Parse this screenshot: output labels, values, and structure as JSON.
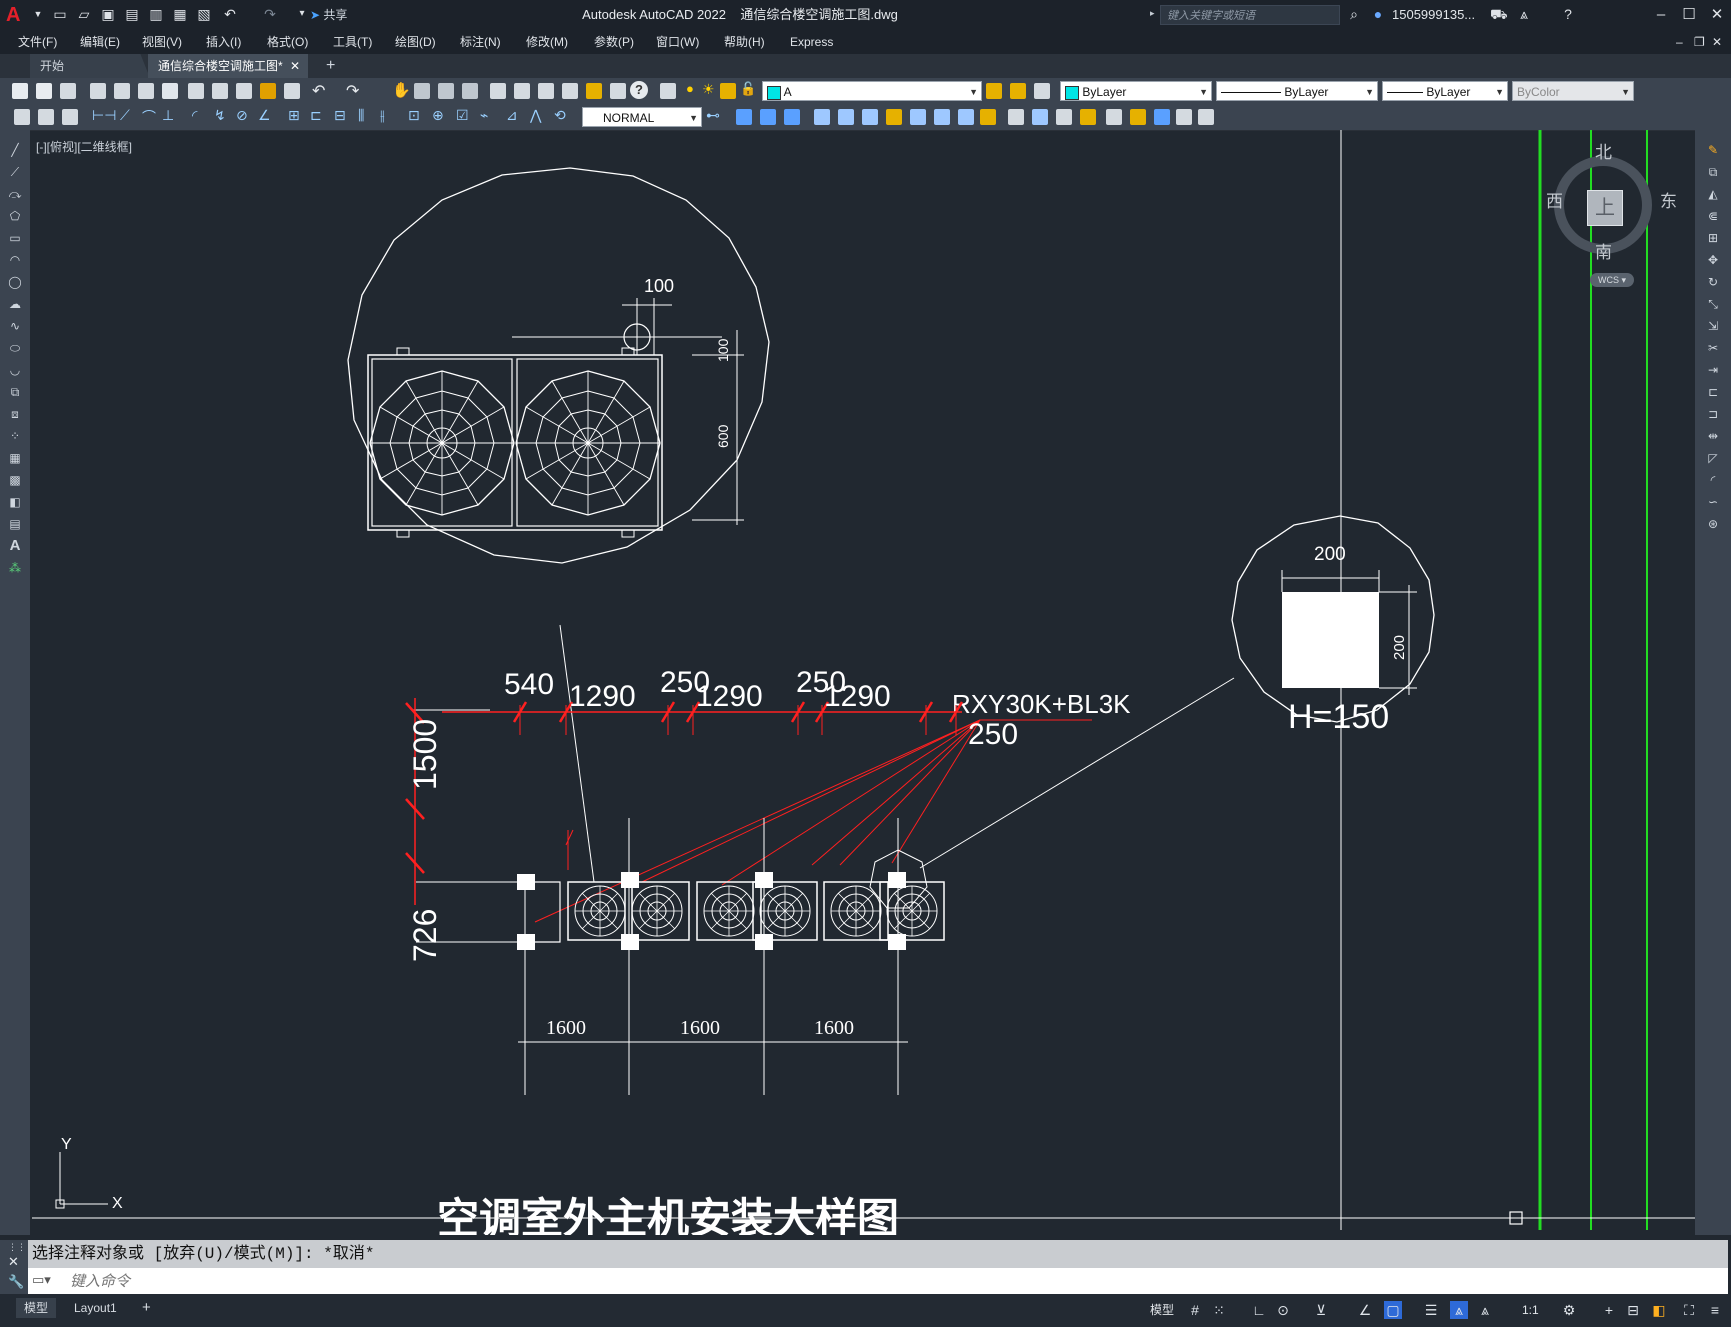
{
  "title_bar": {
    "app_name": "Autodesk AutoCAD 2022",
    "file_name": "通信综合楼空调施工图.dwg",
    "share_label": "共享",
    "search_placeholder": "键入关键字或短语",
    "user_name": "1505999135...",
    "help_label": "?"
  },
  "menu": [
    "文件(F)",
    "编辑(E)",
    "视图(V)",
    "插入(I)",
    "格式(O)",
    "工具(T)",
    "绘图(D)",
    "标注(N)",
    "修改(M)",
    "参数(P)",
    "窗口(W)",
    "帮助(H)",
    "Express"
  ],
  "tabs": {
    "start": "开始",
    "drawing": "通信综合楼空调施工图*",
    "add": "+"
  },
  "toolbar": {
    "layer_name": "A",
    "layer_color": "#00e5e5",
    "color_value": "ByLayer",
    "linetype_value": "ByLayer",
    "lineweight_value": "ByLayer",
    "plotstyle_value": "ByColor",
    "dimstyle_value": "NORMAL"
  },
  "viewport_label": "[-][俯视][二维线框]",
  "viewcube": {
    "north": "北",
    "south": "南",
    "east": "东",
    "west": "西",
    "face": "上",
    "wcs": "WCS"
  },
  "drawing": {
    "detail_top_dims": {
      "d100_top": "100",
      "d100_side": "100",
      "d600": "600"
    },
    "detail_right_dims": {
      "width": "200",
      "height": "200",
      "h_label": "H=150"
    },
    "model_label": "RXY30K+BL3K",
    "top_dims": [
      "540",
      "1290",
      "250",
      "1290",
      "250",
      "1290",
      "250"
    ],
    "left_dims": [
      "1500",
      "726"
    ],
    "bottom_dims": [
      "1600",
      "1600",
      "1600"
    ],
    "title": "空调室外主机安装大样图",
    "ucs_x": "X",
    "ucs_y": "Y"
  },
  "command": {
    "history": "选择注释对象或 [放弃(U)/模式(M)]: *取消*",
    "placeholder": "键入命令"
  },
  "status": {
    "model_tab": "模型",
    "layout_tab": "Layout1",
    "model_space": "模型",
    "scale": "1:1"
  },
  "colors": {
    "accent_red": "#e4202a",
    "dim_red": "#ff2020",
    "green_line": "#22dd22",
    "canvas_bg": "#212830"
  }
}
